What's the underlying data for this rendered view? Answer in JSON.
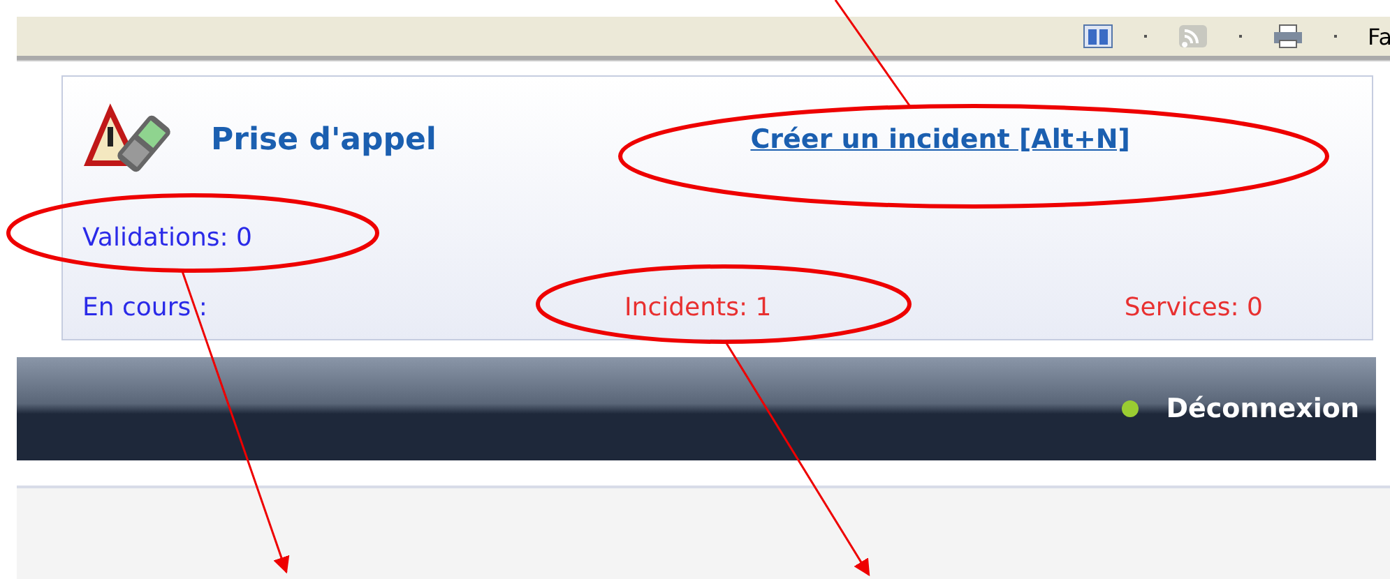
{
  "browser_toolbar": {
    "cut_label": "Fa"
  },
  "panel": {
    "title": "Prise d'appel",
    "create_link": "Créer un incident [Alt+N]",
    "validations": "Validations: 0",
    "in_progress": "En cours :",
    "incidents": "Incidents: 1",
    "services": "Services: 0"
  },
  "nav_bar": {
    "logout": "Déconnexion"
  }
}
